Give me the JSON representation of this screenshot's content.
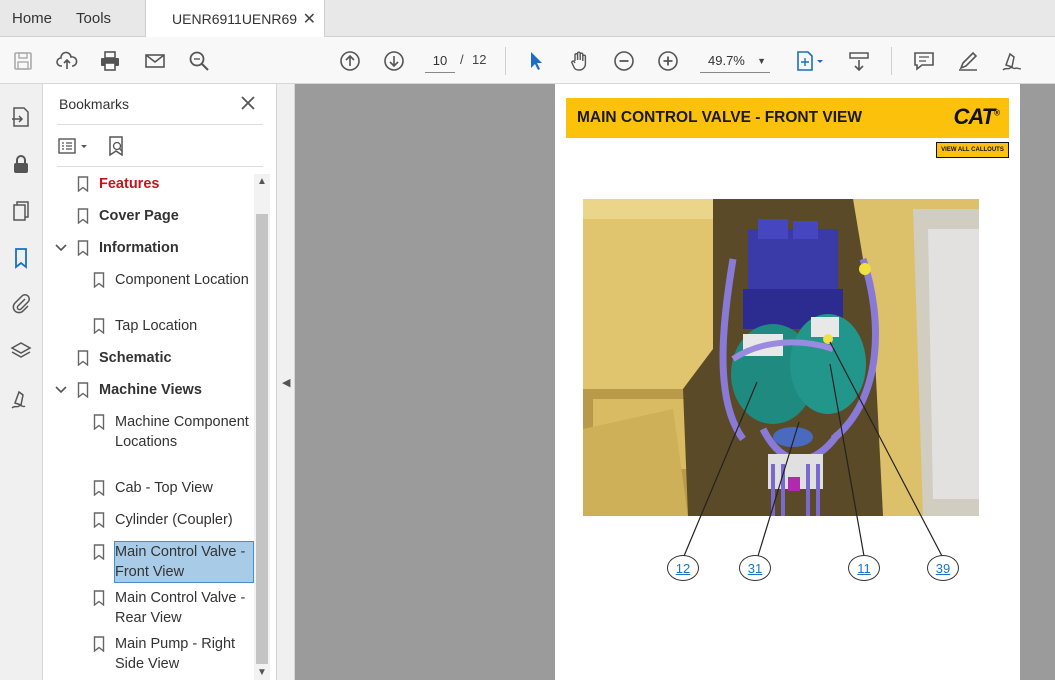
{
  "tabs": {
    "home": "Home",
    "tools": "Tools",
    "document": "UENR6911UENR69...",
    "close_symbol": "✕"
  },
  "toolbar": {
    "icons": [
      "save-icon",
      "cloud-upload-icon",
      "print-icon",
      "mail-icon",
      "zoom-search-icon",
      "prev-page-icon",
      "next-page-icon",
      "select-pointer-icon",
      "hand-icon",
      "zoom-out-icon",
      "zoom-in-icon",
      "fit-page-icon",
      "scroll-mode-icon",
      "comment-icon",
      "highlight-pen-icon",
      "sign-icon"
    ],
    "page_current": "10",
    "page_separator": "/",
    "page_total": "12",
    "zoom": "49.7%"
  },
  "rail": {
    "icons": [
      "export-pdf-icon",
      "lock-icon",
      "pages-icon",
      "bookmark-icon",
      "attachment-icon",
      "layers-icon",
      "signature-icon"
    ]
  },
  "bookmarks": {
    "title": "Bookmarks",
    "items": [
      {
        "label": "Features",
        "level": 0
      },
      {
        "label": "Cover Page",
        "level": 0
      },
      {
        "label": "Information",
        "level": 0
      },
      {
        "label": "Component Location",
        "level": 1
      },
      {
        "label": "Tap Location",
        "level": 1
      },
      {
        "label": "Schematic",
        "level": 0
      },
      {
        "label": "Machine Views",
        "level": 0
      },
      {
        "label": "Machine Component Locations",
        "level": 1
      },
      {
        "label": "Cab - Top View",
        "level": 1
      },
      {
        "label": "Cylinder (Coupler)",
        "level": 1
      },
      {
        "label": "Main Control Valve - Front View",
        "level": 1
      },
      {
        "label": "Main Control Valve - Rear View",
        "level": 1
      },
      {
        "label": "Main Pump - Right Side View",
        "level": 1
      }
    ]
  },
  "page": {
    "banner_title": "MAIN CONTROL VALVE - FRONT VIEW",
    "logo": "CAT",
    "logo_mark": "®",
    "view_all_callouts": "VIEW ALL CALLOUTS",
    "callouts": [
      "12",
      "31",
      "11",
      "39"
    ],
    "colors": {
      "banner": "#fcc10a",
      "link": "#1a74c4",
      "machine_yellow": "#c9a850",
      "valve_blue": "#3a3aa8",
      "pump_teal": "#1f8a80"
    }
  }
}
